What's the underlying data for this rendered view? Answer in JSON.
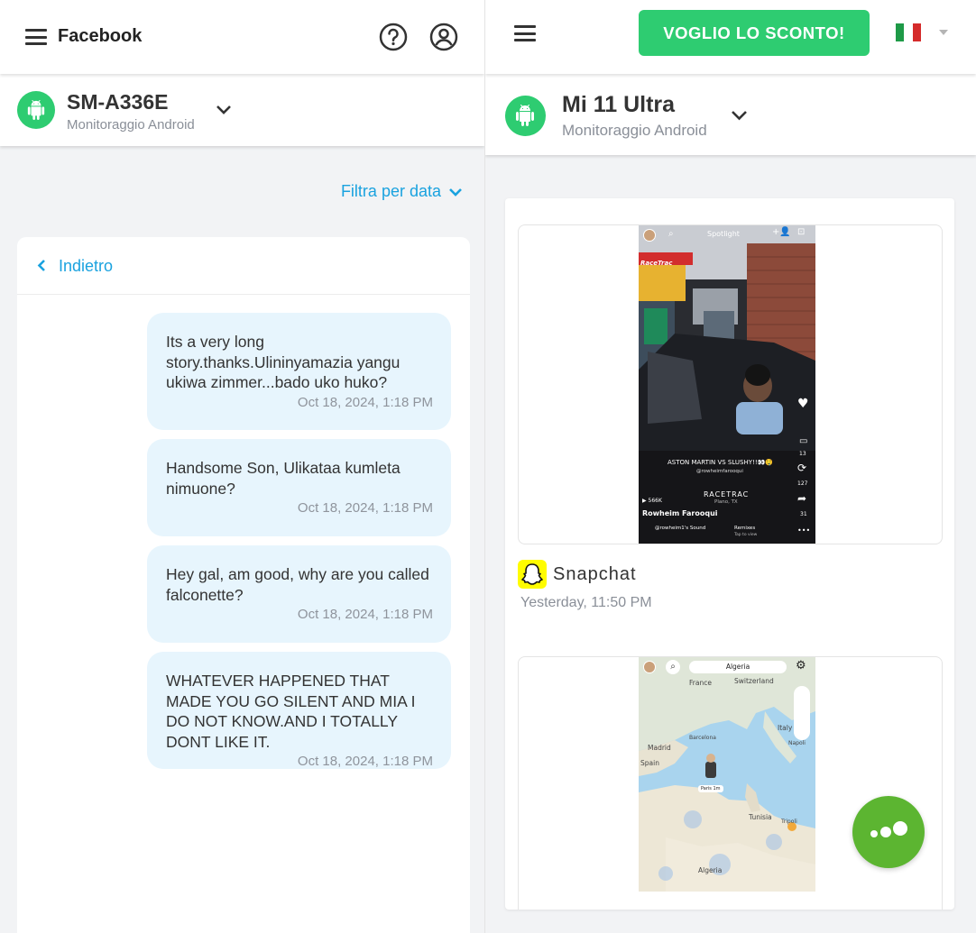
{
  "left_panel": {
    "app_title": "Facebook",
    "device": {
      "name": "SM-A336E",
      "subtitle": "Monitoraggio Android"
    },
    "filter_label": "Filtra per data",
    "back_label": "Indietro",
    "messages": [
      {
        "text": "Its a very long story.thanks.Ulininyamazia yangu ukiwa zimmer...bado uko huko?",
        "time": "Oct 18, 2024, 1:18 PM"
      },
      {
        "text": "Handsome Son, Ulikataa kumleta nimuone?",
        "time": "Oct 18, 2024, 1:18 PM"
      },
      {
        "text": "Hey gal, am good, why are you called falconette?",
        "time": "Oct 18, 2024, 1:18 PM"
      },
      {
        "text": "WHATEVER HAPPENED THAT MADE YOU GO SILENT AND MIA I DO NOT KNOW.AND I TOTALLY DONT LIKE IT.",
        "time": "Oct 18, 2024, 1:18 PM"
      }
    ]
  },
  "right_panel": {
    "cta_label": "VOGLIO LO SCONTO!",
    "language_flag": "Italian flag",
    "device": {
      "name": "Mi 11 Ultra",
      "subtitle": "Monitoraggio Android"
    },
    "entries": [
      {
        "app": "Snapchat",
        "time": "Yesterday,  11:50 PM",
        "screenshot": {
          "top_label": "Spotlight",
          "brand_sign": "RaceTrac",
          "caption": "ASTON MARTIN VS SLUSHY!!👀🤤",
          "handle": "@rowheimfarooqui",
          "location": "RACETRAC",
          "location_sub": "Plano, TX",
          "views": "▶ 566K",
          "author": "Rowheim Farooqui",
          "sound": "@rowheim1's Sound",
          "remixes": "Remixes",
          "remixes_sub": "Tap to view",
          "count_comments": "13",
          "count_reposts": "127",
          "count_shares": "31"
        }
      },
      {
        "app": "Snapchat",
        "screenshot": {
          "search_label": "Algeria",
          "places": [
            "France",
            "Switzerland",
            "Italy",
            "Napoli",
            "Madrid",
            "Barcelona",
            "Spain",
            "Tunisia",
            "Tripoli",
            "Algeria"
          ],
          "pin_label": "Paris 1m"
        }
      }
    ]
  },
  "colors": {
    "accent_blue": "#1aa2df",
    "brand_green": "#2ecc71",
    "fab_green": "#5cb531",
    "bubble_bg": "#e7f5fd",
    "snapchat_yellow": "#fffc00"
  },
  "icons": [
    "menu-icon",
    "help-icon",
    "account-icon",
    "android-icon",
    "chevron-down-icon",
    "chevron-left-icon",
    "snapchat-ghost-icon",
    "dots-icon"
  ]
}
